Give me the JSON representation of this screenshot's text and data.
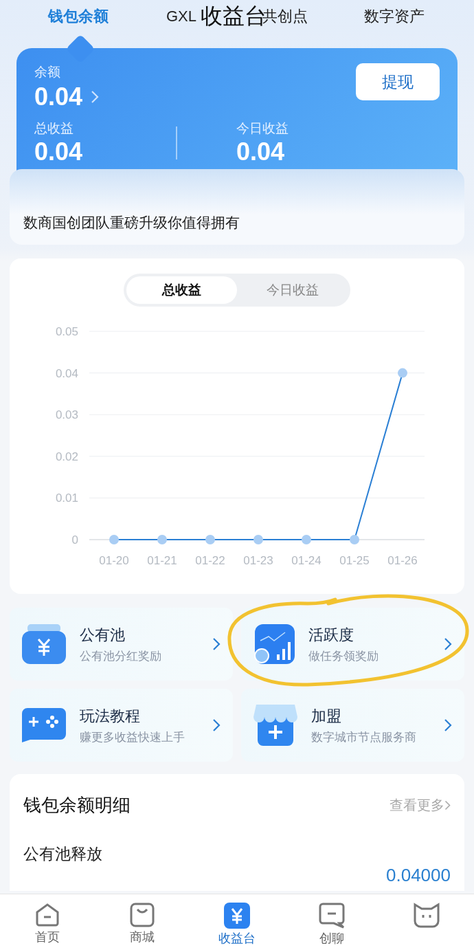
{
  "header": {
    "title": "收益台",
    "tabs": [
      {
        "label": "钱包余额",
        "selected": true
      },
      {
        "label": "GXL",
        "selected": false
      },
      {
        "label": "共创点",
        "selected": false
      },
      {
        "label": "数字资产",
        "selected": false
      }
    ]
  },
  "wallet": {
    "balance_label": "余额",
    "balance": "0.04",
    "withdraw_button": "提现",
    "stats": [
      {
        "label": "总收益",
        "value": "0.04"
      },
      {
        "label": "今日收益",
        "value": "0.04"
      }
    ]
  },
  "banner": "数商国创团队重磅升级你值得拥有",
  "earnings": {
    "toggle": [
      {
        "label": "总收益",
        "selected": true
      },
      {
        "label": "今日收益",
        "selected": false
      }
    ],
    "chart_data": {
      "type": "line",
      "categories": [
        "01-20",
        "01-21",
        "01-22",
        "01-23",
        "01-24",
        "01-25",
        "01-26"
      ],
      "yticks": [
        0,
        0.01,
        0.02,
        0.03,
        0.04,
        0.05
      ],
      "ylim": [
        0,
        0.05
      ],
      "grid": true,
      "series": [
        {
          "color": "#2a7fd4",
          "marker": true,
          "values": [
            0,
            0,
            0,
            0,
            0,
            0,
            0.04
          ]
        }
      ]
    }
  },
  "features": [
    {
      "title": "公有池",
      "subtitle": "公有池分红奖励"
    },
    {
      "title": "活跃度",
      "subtitle": "做任务领奖励"
    },
    {
      "title": "玩法教程",
      "subtitle": "赚更多收益快速上手"
    },
    {
      "title": "加盟",
      "subtitle": "数字城市节点服务商"
    }
  ],
  "details": {
    "title": "钱包余额明细",
    "more_link": "查看更多",
    "rows": [
      {
        "label": "公有池释放",
        "amount": "0.04000"
      }
    ]
  },
  "bottom_nav": [
    {
      "label": "首页",
      "selected": false
    },
    {
      "label": "商城",
      "selected": false
    },
    {
      "label": "收益台",
      "selected": true
    },
    {
      "label": "创聊",
      "selected": false
    },
    {
      "selected": false
    }
  ]
}
